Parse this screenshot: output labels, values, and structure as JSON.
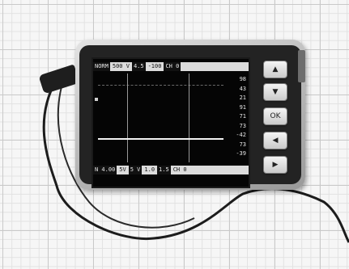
{
  "screen": {
    "top_bar": [
      "NORM",
      "500 V",
      "4.5",
      "-100",
      "CH 0"
    ],
    "bottom_bar": [
      "N 4.00",
      "5V",
      "5 V",
      "1.0",
      "1.5",
      "CH 0"
    ],
    "readouts": [
      "98",
      "43",
      "21",
      "91",
      "71",
      "73",
      "-42",
      "73",
      "-39"
    ]
  },
  "buttons": {
    "up": "▲",
    "down": "▼",
    "ok": "OK",
    "left": "◀",
    "right": "▶"
  },
  "colors": {
    "background": "#f6f6f6",
    "device_shell": "#bdbdbd",
    "screen": "#050505",
    "trace": "#f2f2f2"
  },
  "icons": [
    "up-arrow-icon",
    "down-arrow-icon",
    "left-arrow-icon",
    "right-arrow-icon"
  ]
}
